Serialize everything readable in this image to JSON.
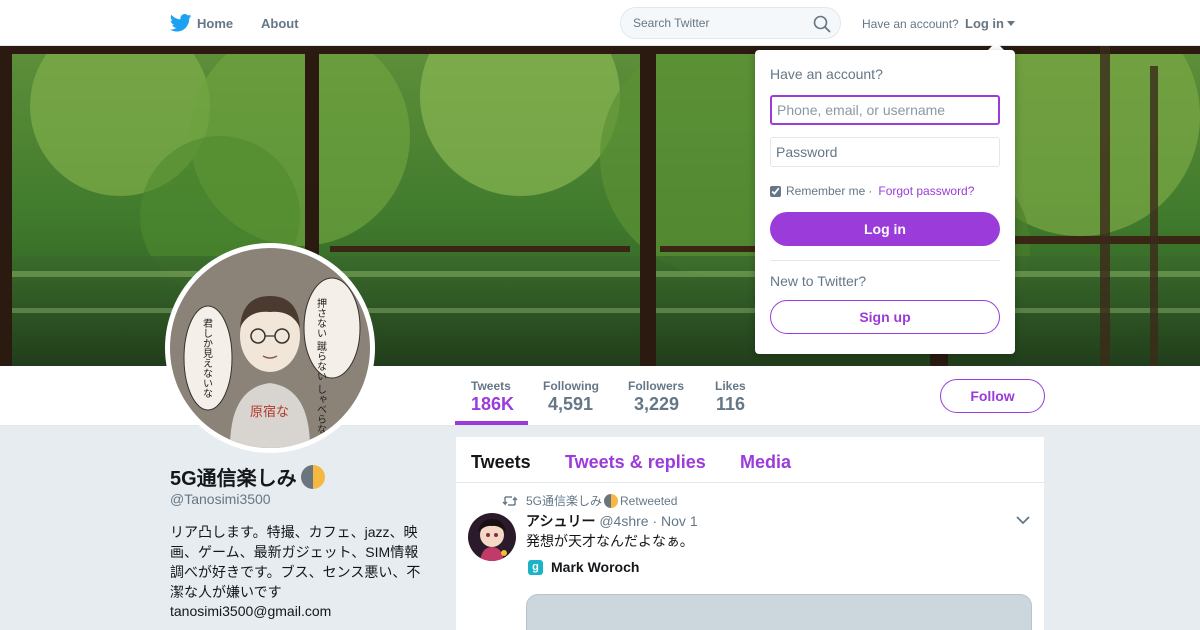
{
  "colors": {
    "accent": "#9B3BD9",
    "twitter_blue": "#1DA1F2",
    "muted": "#657786",
    "background": "#e6ecf0"
  },
  "nav": {
    "logo_icon": "twitter-bird-icon",
    "home_label": "Home",
    "about_label": "About",
    "search_placeholder": "Search Twitter",
    "have_account": "Have an account?",
    "login_label": "Log in"
  },
  "profile": {
    "display_name": "5G通信楽しみ",
    "name_emoji": "last-quarter-moon-icon",
    "screen_name": "@Tanosimi3500",
    "bio": "リア凸します。特撮、カフェ、jazz、映画、ゲーム、最新ガジェット、SIM情報調べが好きです。ブス、センス悪い、不潔な人が嫌いです",
    "email": "tanosimi3500@gmail.com",
    "avatar_text_right": "押さない 蹴らない しゃべらない",
    "avatar_text_left": "君しか見えないな",
    "avatar_shirt_text": "原宿な"
  },
  "stats": [
    {
      "label": "Tweets",
      "value": "186K",
      "active": true
    },
    {
      "label": "Following",
      "value": "4,591",
      "active": false
    },
    {
      "label": "Followers",
      "value": "3,229",
      "active": false
    },
    {
      "label": "Likes",
      "value": "116",
      "active": false
    }
  ],
  "follow_label": "Follow",
  "timeline": {
    "tabs": [
      "Tweets",
      "Tweets & replies",
      "Media"
    ],
    "active_tab": "Tweets",
    "tweet": {
      "retweeter": "5G通信楽しみ",
      "retweeted_label": "Retweeted",
      "author_name": "アシュリー",
      "author_handle": "@4shre",
      "date": "Nov 1",
      "text": "発想が天才なんだよなぁ。",
      "quoted_author": "Mark Woroch",
      "quoted_badge": "g"
    }
  },
  "login_dropdown": {
    "title": "Have an account?",
    "username_placeholder": "Phone, email, or username",
    "password_placeholder": "Password",
    "remember_me": "Remember me",
    "separator": "·",
    "forgot_password": "Forgot password?",
    "login_button": "Log in",
    "new_to_twitter": "New to Twitter?",
    "signup_button": "Sign up",
    "remember_checked": true
  }
}
